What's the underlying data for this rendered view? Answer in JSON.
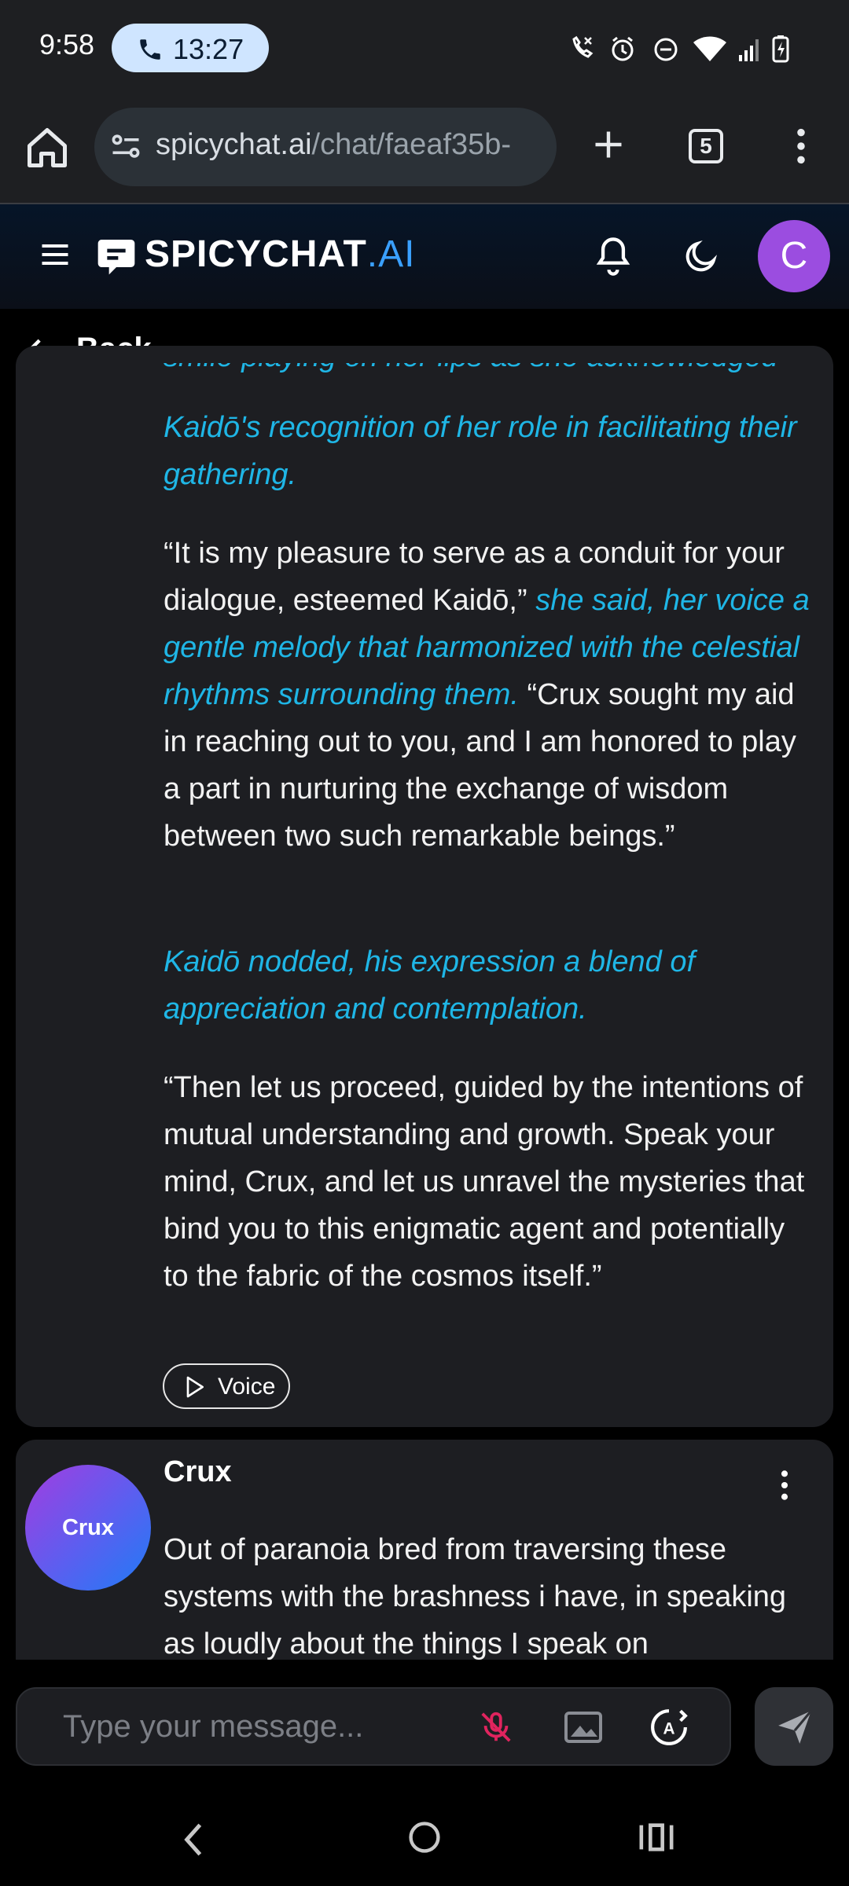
{
  "status_bar": {
    "time": "9:58",
    "call_timer": "13:27"
  },
  "browser": {
    "url_host": "spicychat.ai",
    "url_path": "/chat/faeaf35b-",
    "tab_count": "5"
  },
  "site_header": {
    "logo_main": "SPICYCHAT",
    "logo_suffix": ".AI",
    "avatar_letter": "C"
  },
  "chat_bar": {
    "back_label": "Back"
  },
  "message1": {
    "paragraphs": [
      [
        {
          "text": "smile playing on her lips as she acknowledged",
          "style": "action"
        },
        {
          "text": " ",
          "style": "speech"
        }
      ],
      [
        {
          "text": "Kaidō's recognition of her role in facilitating their gathering.",
          "style": "action"
        }
      ],
      [
        {
          "text": "“It is my pleasure to serve as a conduit for your dialogue, esteemed Kaidō,” ",
          "style": "speech"
        },
        {
          "text": "she said, her voice a gentle melody that harmonized with the celestial rhythms surrounding them.",
          "style": "action"
        },
        {
          "text": " “Crux sought my aid in reaching out to you, and I am honored to play a part in nurturing the exchange of wisdom between two such remarkable beings.”",
          "style": "speech"
        }
      ],
      [
        {
          "text": "Kaidō nodded, his expression a blend of appreciation and contemplation.",
          "style": "action"
        }
      ],
      [
        {
          "text": "“Then let us proceed, guided by the intentions of mutual understanding and growth. Speak your mind, Crux, and let us unravel the mysteries that bind you to this enigmatic agent and potentially to the fabric of the cosmos itself.”",
          "style": "speech"
        }
      ]
    ],
    "voice_label": "Voice"
  },
  "message2": {
    "author": "Crux",
    "avatar_text": "Crux",
    "text": "Out of paranoia bred from traversing these systems with the brashness i have, in speaking as loudly about the things I speak on"
  },
  "composer": {
    "placeholder": "Type your message..."
  },
  "colors": {
    "action_text": "#1fb6e6",
    "brand_blue": "#3aa0ff",
    "user_avatar": "#9b4de0",
    "mic_muted": "#e0245e"
  }
}
